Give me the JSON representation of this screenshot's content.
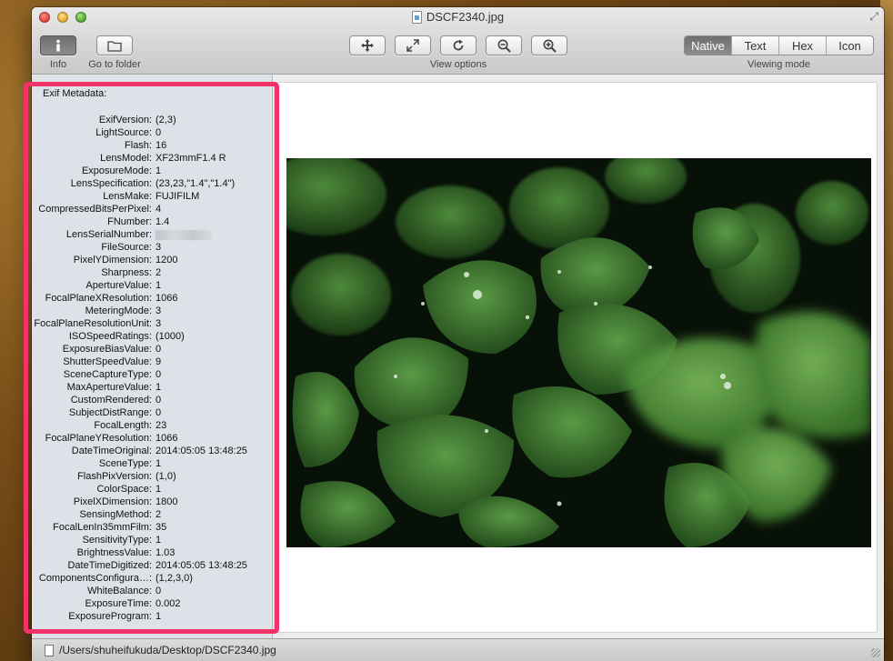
{
  "window": {
    "title": "DSCF2340.jpg"
  },
  "toolbar": {
    "info_label": "Info",
    "go_to_folder_label": "Go to folder",
    "view_options_label": "View options",
    "viewing_mode_label": "Viewing mode",
    "modes": [
      "Native",
      "Text",
      "Hex",
      "Icon"
    ],
    "active_mode": "Native"
  },
  "sidebar": {
    "heading": "Exif Metadata:",
    "rows": [
      {
        "key": "ExifVersion:",
        "value": "(2,3)"
      },
      {
        "key": "LightSource:",
        "value": "0"
      },
      {
        "key": "Flash:",
        "value": "16"
      },
      {
        "key": "LensModel:",
        "value": "XF23mmF1.4 R"
      },
      {
        "key": "ExposureMode:",
        "value": "1"
      },
      {
        "key": "LensSpecification:",
        "value": "(23,23,\"1.4\",\"1.4\")"
      },
      {
        "key": "LensMake:",
        "value": "FUJIFILM"
      },
      {
        "key": "CompressedBitsPerPixel:",
        "value": "4"
      },
      {
        "key": "FNumber:",
        "value": "1.4"
      },
      {
        "key": "LensSerialNumber:",
        "value": ""
      },
      {
        "key": "FileSource:",
        "value": "3"
      },
      {
        "key": "PixelYDimension:",
        "value": "1200"
      },
      {
        "key": "Sharpness:",
        "value": "2"
      },
      {
        "key": "ApertureValue:",
        "value": "1"
      },
      {
        "key": "FocalPlaneXResolution:",
        "value": "1066"
      },
      {
        "key": "MeteringMode:",
        "value": "3"
      },
      {
        "key": "FocalPlaneResolutionUnit:",
        "value": "3"
      },
      {
        "key": "ISOSpeedRatings:",
        "value": "(1000)"
      },
      {
        "key": "ExposureBiasValue:",
        "value": "0"
      },
      {
        "key": "ShutterSpeedValue:",
        "value": "9"
      },
      {
        "key": "SceneCaptureType:",
        "value": "0"
      },
      {
        "key": "MaxApertureValue:",
        "value": "1"
      },
      {
        "key": "CustomRendered:",
        "value": "0"
      },
      {
        "key": "SubjectDistRange:",
        "value": "0"
      },
      {
        "key": "FocalLength:",
        "value": "23"
      },
      {
        "key": "FocalPlaneYResolution:",
        "value": "1066"
      },
      {
        "key": "DateTimeOriginal:",
        "value": "2014:05:05 13:48:25"
      },
      {
        "key": "SceneType:",
        "value": "1"
      },
      {
        "key": "FlashPixVersion:",
        "value": "(1,0)"
      },
      {
        "key": "ColorSpace:",
        "value": "1"
      },
      {
        "key": "PixelXDimension:",
        "value": "1800"
      },
      {
        "key": "SensingMethod:",
        "value": "2"
      },
      {
        "key": "FocalLenIn35mmFilm:",
        "value": "35"
      },
      {
        "key": "SensitivityType:",
        "value": "1"
      },
      {
        "key": "BrightnessValue:",
        "value": "1.03"
      },
      {
        "key": "DateTimeDigitized:",
        "value": "2014:05:05 13:48:25"
      },
      {
        "key": "ComponentsConfigura…:",
        "value": "(1,2,3,0)"
      },
      {
        "key": "WhiteBalance:",
        "value": "0"
      },
      {
        "key": "ExposureTime:",
        "value": "0.002"
      },
      {
        "key": "ExposureProgram:",
        "value": "1"
      }
    ]
  },
  "status": {
    "path": "/Users/shuheifukuda/Desktop/DSCF2340.jpg"
  },
  "colors": {
    "highlight": "#f2336a",
    "sidebar_bg": "#dde2e8"
  },
  "icons": [
    "info-icon",
    "folder-icon",
    "move-icon",
    "fit-icon",
    "rotate-icon",
    "zoom-out-icon",
    "zoom-in-icon"
  ]
}
